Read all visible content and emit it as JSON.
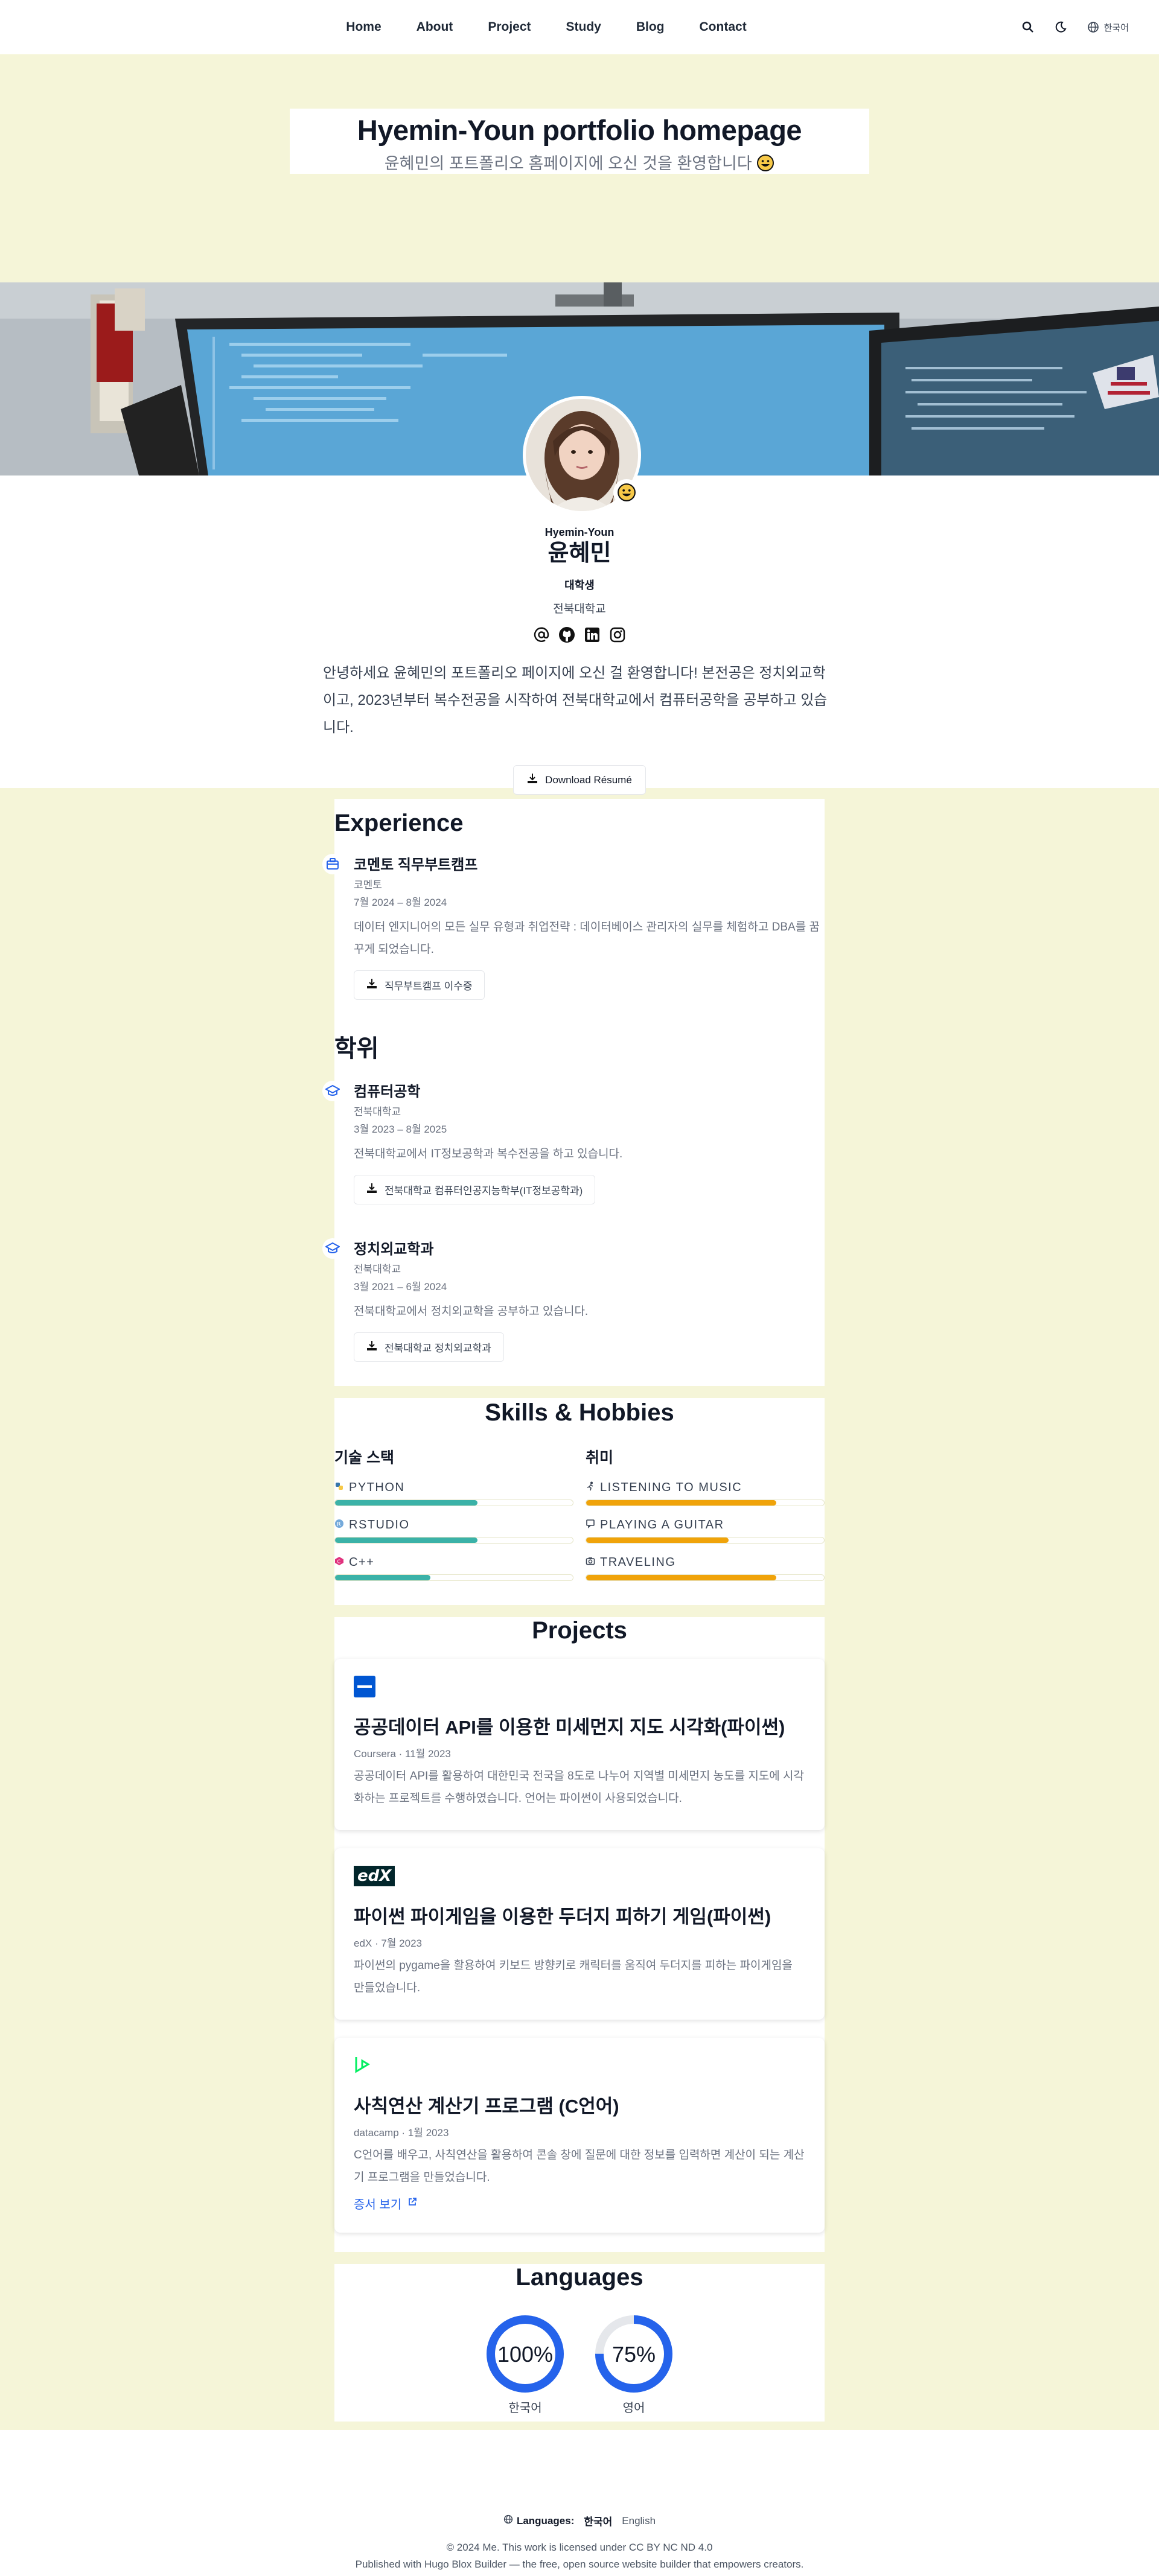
{
  "nav": {
    "items": [
      "Home",
      "About",
      "Project",
      "Study",
      "Blog",
      "Contact"
    ],
    "language": "한국어",
    "icons": [
      "search-icon",
      "moon-icon",
      "globe-icon"
    ]
  },
  "hero": {
    "title": "Hyemin-Youn portfolio homepage",
    "subtitle": "윤혜민의 포트폴리오 홈페이지에 오신 것을 환영합니다"
  },
  "profile": {
    "name_en": "Hyemin-Youn",
    "name_ko": "윤혜민",
    "role": "대학생",
    "school": "전북대학교",
    "icons": [
      "at-icon",
      "github-icon",
      "linkedin-icon",
      "instagram-icon"
    ],
    "bio": "안녕하세요 윤혜민의 포트폴리오 페이지에 오신 걸 환영합니다! 본전공은 정치외교학이고, 2023년부터 복수전공을 시작하여 전북대학교에서 컴퓨터공학을 공부하고 있습니다.",
    "resume_button": "Download Résumé"
  },
  "experience": {
    "heading": "Experience",
    "items": [
      {
        "title": "코멘토 직무부트캠프",
        "org": "코멘토",
        "date": "7월 2024 – 8월 2024",
        "desc": "데이터 엔지니어의 모든 실무 유형과 취업전략 : 데이터베이스 관리자의 실무를 체험하고 DBA를 꿈꾸게 되었습니다.",
        "button": "직무부트캠프 이수증"
      }
    ]
  },
  "education": {
    "heading": "학위",
    "items": [
      {
        "title": "컴퓨터공학",
        "org": "전북대학교",
        "date": "3월 2023 – 8월 2025",
        "desc": "전북대학교에서 IT정보공학과 복수전공을 하고 있습니다.",
        "button": "전북대학교 컴퓨터인공지능학부(IT정보공학과)"
      },
      {
        "title": "정치외교학과",
        "org": "전북대학교",
        "date": "3월 2021 – 6월 2024",
        "desc": "전북대학교에서 정치외교학을 공부하고 있습니다.",
        "button": "전북대학교 정치외교학과"
      }
    ]
  },
  "skills": {
    "heading": "Skills & Hobbies",
    "tech_heading": "기술 스택",
    "hobby_heading": "취미",
    "tech": [
      {
        "name": "Python",
        "level": 0.6,
        "color": "#3bb2a8"
      },
      {
        "name": "RStudio",
        "level": 0.6,
        "color": "#3bb2a8"
      },
      {
        "name": "C++",
        "level": 0.4,
        "color": "#3bb2a8"
      }
    ],
    "hobbies": [
      {
        "name": "Listening to Music",
        "level": 0.8,
        "color": "#f0a30a"
      },
      {
        "name": "Playing a Guitar",
        "level": 0.6,
        "color": "#f0a30a"
      },
      {
        "name": "Traveling",
        "level": 0.8,
        "color": "#f0a30a"
      }
    ]
  },
  "projects": {
    "heading": "Projects",
    "items": [
      {
        "logo": "coursera-logo",
        "title": "공공데이터 API를 이용한 미세먼지 지도 시각화(파이썬)",
        "meta": "Coursera · 11월 2023",
        "desc": "공공데이터 API를 활용하여 대한민국 전국을 8도로 나누어 지역별 미세먼지 농도를 지도에 시각화하는 프로젝트를 수행하였습니다. 언어는 파이썬이 사용되었습니다."
      },
      {
        "logo": "edx-logo",
        "logo_text": "edX",
        "title": "파이썬 파이게임을 이용한 두더지 피하기 게임(파이썬)",
        "meta": "edX · 7월 2023",
        "desc": "파이썬의 pygame을 활용하여 키보드 방향키로 캐릭터를 움직여 두더지를 피하는 파이게임을 만들었습니다."
      },
      {
        "logo": "datacamp-logo",
        "title": "사칙연산 계산기 프로그램 (C언어)",
        "meta": "datacamp · 1월 2023",
        "desc": "C언어를 배우고, 사칙연산을 활용하여 콘솔 창에 질문에 대한 정보를 입력하면 계산이 되는 계산기 프로그램을 만들었습니다.",
        "link": "증서 보기"
      }
    ]
  },
  "languages": {
    "heading": "Languages",
    "items": [
      {
        "name": "한국어",
        "percent": 100,
        "label": "100%"
      },
      {
        "name": "영어",
        "percent": 75,
        "label": "75%"
      }
    ]
  },
  "footer": {
    "languages_label": "Languages:",
    "lang_current": "한국어",
    "lang_other": "English",
    "copyright": "© 2024 Me. This work is licensed under CC BY NC ND 4.0",
    "published": "Published with Hugo Blox Builder — the free, open source website builder that empowers creators."
  },
  "colors": {
    "page_bg": "#f5f5d8",
    "accent": "#2563eb",
    "skill_teal": "#3bb2a8",
    "hobby_orange": "#f0a30a"
  }
}
